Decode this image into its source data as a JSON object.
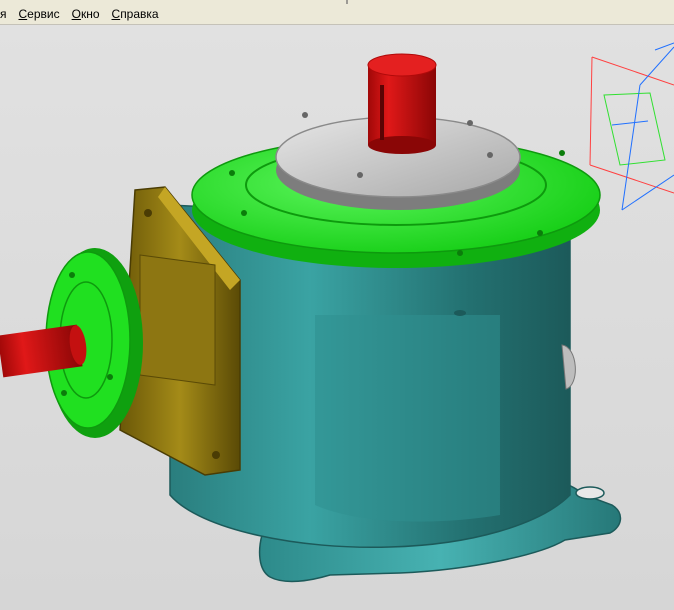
{
  "menu": {
    "items": [
      {
        "id": "view-partial",
        "prefix": "",
        "underlined": "",
        "rest": "я"
      },
      {
        "id": "service",
        "prefix": "",
        "underlined": "С",
        "rest": "ервис"
      },
      {
        "id": "window",
        "prefix": "",
        "underlined": "О",
        "rest": "кно"
      },
      {
        "id": "help",
        "prefix": "",
        "underlined": "С",
        "rest": "правка"
      }
    ]
  },
  "viewport": {
    "background": "#dcdcdc",
    "model": {
      "housing_color": "#2f8f8f",
      "flange_color": "#22e622",
      "adapter_color": "#8a7410",
      "shaft_color": "#d01010",
      "cover_color": "#c8c8c8"
    },
    "triad_icon": "coordinate-axes-icon"
  }
}
